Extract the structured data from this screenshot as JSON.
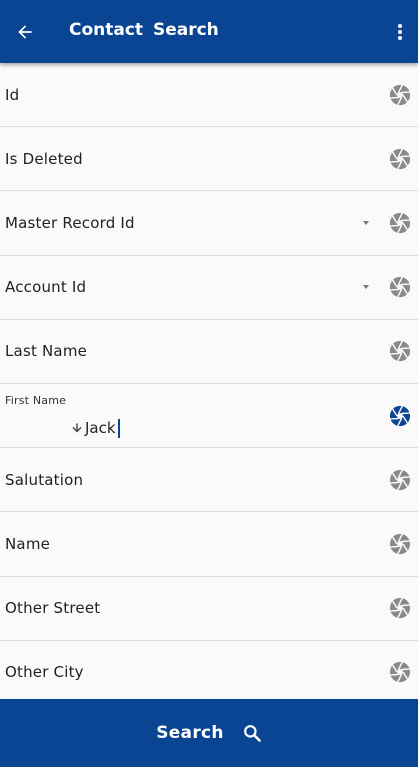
{
  "app": {
    "title": "Contact  Search"
  },
  "colors": {
    "primary": "#0a4594",
    "icon_gray": "#8a8a8a",
    "background": "#fafafa"
  },
  "toolbar": {
    "back_icon": "arrow-left-icon",
    "menu_icon": "more-vert-icon"
  },
  "fields": [
    {
      "label": "Id",
      "value": "",
      "dropdown": false,
      "active": false
    },
    {
      "label": "Is Deleted",
      "value": "",
      "dropdown": false,
      "active": false
    },
    {
      "label": "Master Record Id",
      "value": "",
      "dropdown": true,
      "active": false
    },
    {
      "label": "Account Id",
      "value": "",
      "dropdown": true,
      "active": false
    },
    {
      "label": "Last Name",
      "value": "",
      "dropdown": false,
      "active": false
    },
    {
      "label": "First Name",
      "value": "Jack",
      "dropdown": false,
      "active": true
    },
    {
      "label": "Salutation",
      "value": "",
      "dropdown": false,
      "active": false
    },
    {
      "label": "Name",
      "value": "",
      "dropdown": false,
      "active": false
    },
    {
      "label": "Other Street",
      "value": "",
      "dropdown": false,
      "active": false
    },
    {
      "label": "Other City",
      "value": "",
      "dropdown": false,
      "active": false
    }
  ],
  "footer": {
    "search_label": "Search",
    "search_icon": "search-icon"
  }
}
